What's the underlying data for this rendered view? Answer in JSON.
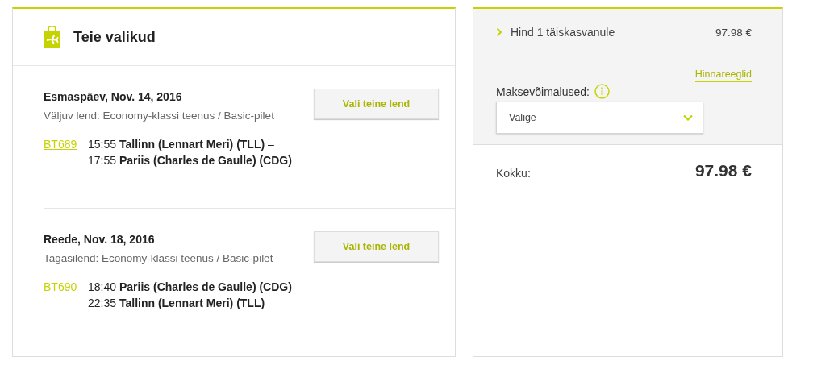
{
  "choices": {
    "title": "Teie valikud",
    "flights": [
      {
        "date": "Esmaspäev, Nov. 14, 2016",
        "fare": "Väljuv lend: Economy-klassi teenus / Basic-pilet",
        "button": "Vali teine lend",
        "number": "BT689",
        "legs": [
          {
            "time": "15:55",
            "place": "Tallinn (Lennart Meri) (TLL)",
            "dash": "–"
          },
          {
            "time": "17:55",
            "place": "Pariis (Charles de Gaulle) (CDG)"
          }
        ]
      },
      {
        "date": "Reede, Nov. 18, 2016",
        "fare": "Tagasilend: Economy-klassi teenus / Basic-pilet",
        "button": "Vali teine lend",
        "number": "BT690",
        "legs": [
          {
            "time": "18:40",
            "place": "Pariis (Charles de Gaulle) (CDG)",
            "dash": "–"
          },
          {
            "time": "22:35",
            "place": "Tallinn (Lennart Meri) (TLL)"
          }
        ]
      }
    ]
  },
  "summary": {
    "price_row": {
      "label": "Hind 1 täiskasvanule",
      "amount": "97.98 €",
      "expanded": false
    },
    "rules_link": "Hinnareeglid",
    "payment": {
      "label": "Maksevõimalused:",
      "value": "Valige"
    },
    "total": {
      "label": "Kokku:",
      "amount": "97.98 €"
    }
  }
}
